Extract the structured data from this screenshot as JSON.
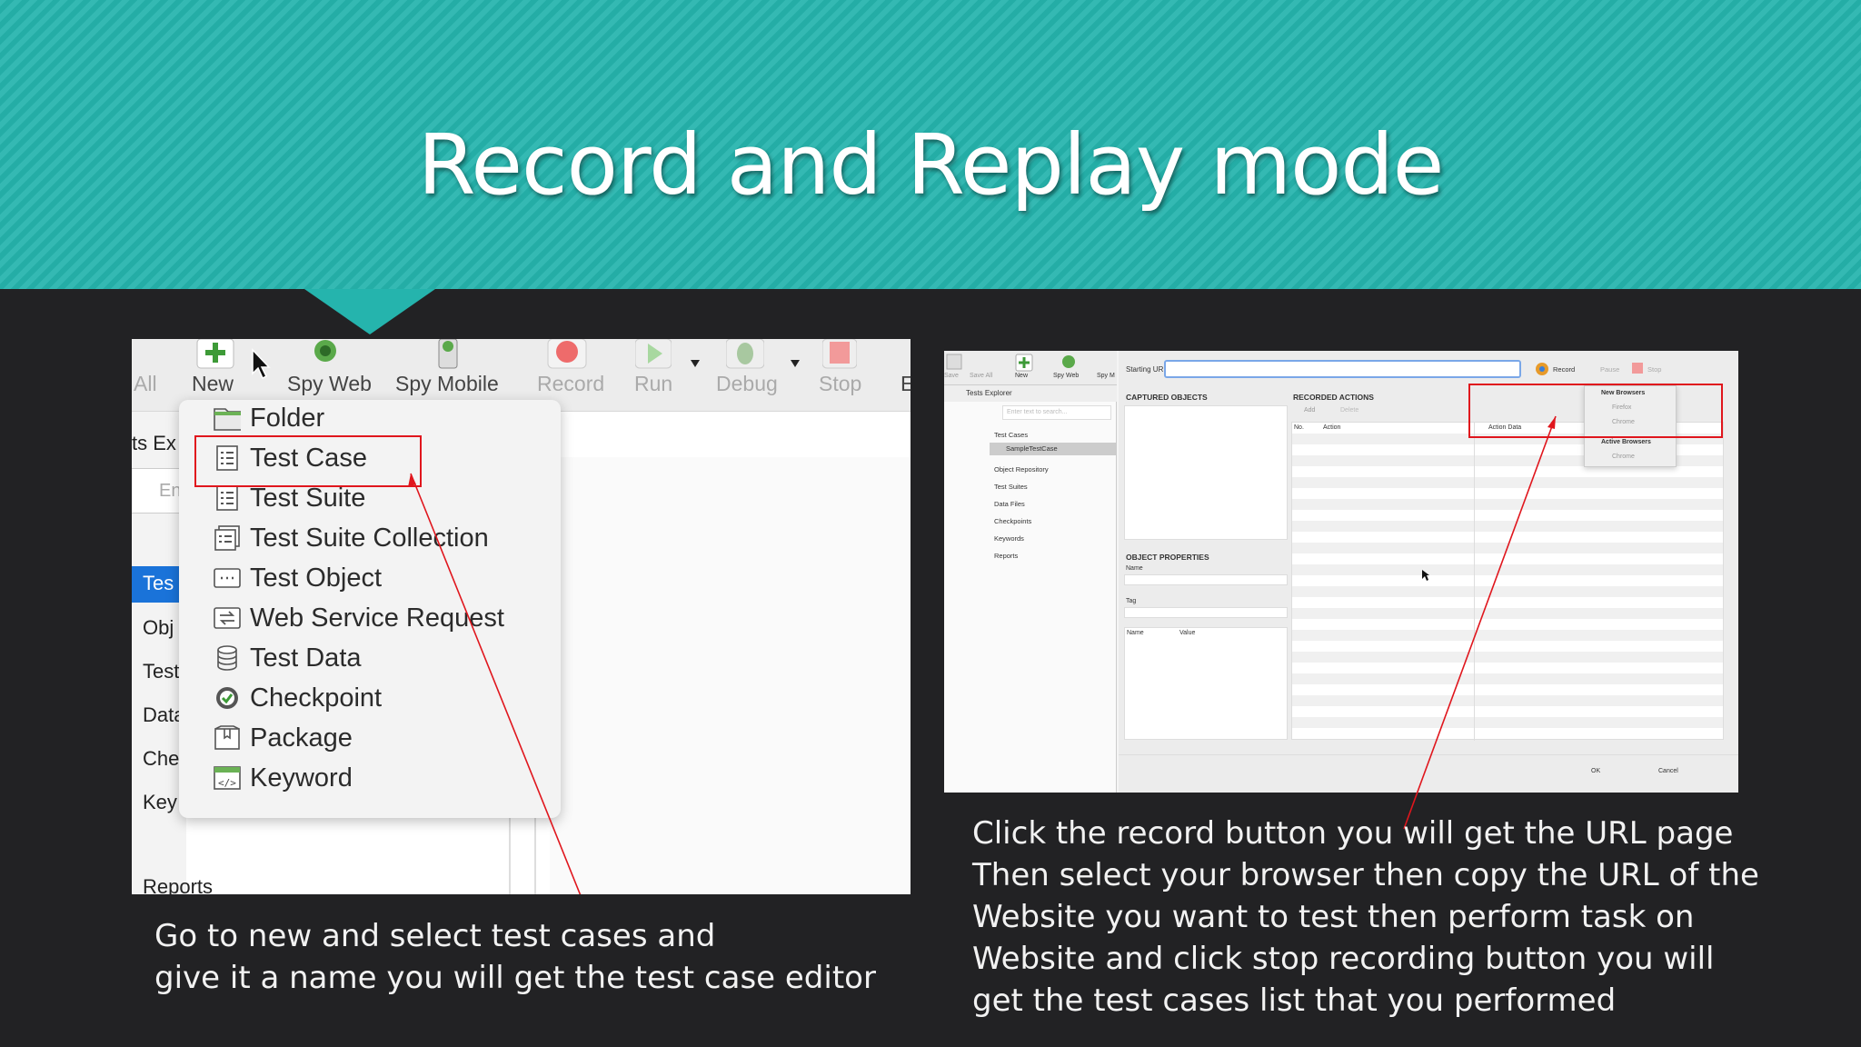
{
  "slide": {
    "title": "Record and Replay mode",
    "accent_color": "#25b4ad",
    "background_color": "#222224"
  },
  "left_screenshot": {
    "toolbar": [
      {
        "label": "All",
        "icon": "none"
      },
      {
        "label": "New",
        "icon": "plus-icon"
      },
      {
        "label": "Spy Web",
        "icon": "spy-web-icon"
      },
      {
        "label": "Spy Mobile",
        "icon": "spy-mobile-icon"
      },
      {
        "label": "Record",
        "icon": "record-icon"
      },
      {
        "label": "Run",
        "icon": "run-icon"
      },
      {
        "label": "Debug",
        "icon": "debug-icon"
      },
      {
        "label": "Stop",
        "icon": "stop-icon"
      },
      {
        "label": "E",
        "icon": "none"
      }
    ],
    "sidebar": [
      "ts Ex",
      "En",
      "Tes",
      "Obj",
      "Test",
      "Data",
      "Che",
      "Key",
      "Reports"
    ],
    "new_menu": [
      {
        "label": "Folder",
        "icon": "folder-icon"
      },
      {
        "label": "Test Case",
        "icon": "test-case-icon"
      },
      {
        "label": "Test Suite",
        "icon": "test-suite-icon"
      },
      {
        "label": "Test Suite Collection",
        "icon": "test-suite-collection-icon"
      },
      {
        "label": "Test Object",
        "icon": "test-object-icon"
      },
      {
        "label": "Web Service Request",
        "icon": "web-service-icon"
      },
      {
        "label": "Test Data",
        "icon": "test-data-icon"
      },
      {
        "label": "Checkpoint",
        "icon": "checkpoint-icon"
      },
      {
        "label": "Package",
        "icon": "package-icon"
      },
      {
        "label": "Keyword",
        "icon": "keyword-icon"
      }
    ],
    "highlight_color": "#e0161d"
  },
  "right_screenshot": {
    "toolbar_labels": [
      "Save",
      "Save All",
      "New",
      "Spy Web",
      "Spy M"
    ],
    "starting_url_label": "Starting URL",
    "record_label": "Record",
    "pause_label": "Pause",
    "stop_label": "Stop",
    "explorer_title": "Tests Explorer",
    "search_placeholder": "Enter text to search...",
    "tree": [
      "Test Cases",
      "SampleTestCase",
      "Object Repository",
      "Test Suites",
      "Data Files",
      "Checkpoints",
      "Keywords",
      "Reports"
    ],
    "captured_objects": "CAPTURED OBJECTS",
    "object_properties": "OBJECT PROPERTIES",
    "prop_name": "Name",
    "prop_tag": "Tag",
    "col_name": "Name",
    "col_value": "Value",
    "recorded_actions": "RECORDED ACTIONS",
    "add_label": "Add",
    "delete_label": "Delete",
    "col_no": "No.",
    "col_action": "Action",
    "col_action_data": "Action Data",
    "dropdown": {
      "new_browsers": "New Browsers",
      "firefox": "Firefox",
      "chrome": "Chrome",
      "active_browsers": "Active Browsers",
      "active_chrome": "Chrome"
    },
    "ok_label": "OK",
    "cancel_label": "Cancel"
  },
  "captions": {
    "left": [
      "Go to new and select test cases and",
      "give it a name you will get the test case editor"
    ],
    "right": [
      "Click the record button you will get the URL page",
      "Then select your browser then copy the URL of the",
      "Website  you want to test then perform task on",
      "Website and click stop recording button you will",
      "get the test cases list that you performed"
    ]
  }
}
